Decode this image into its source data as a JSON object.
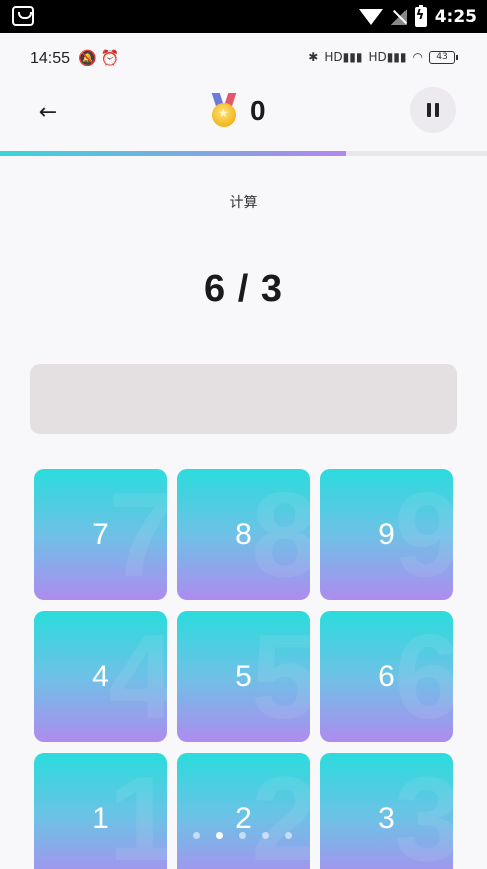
{
  "system_bar": {
    "time": "4:25"
  },
  "status_bar": {
    "time": "14:55",
    "icons_left": [
      "bell-off-icon",
      "alarm-icon"
    ],
    "icons_right": [
      "bluetooth-icon",
      "signal-hd-icon",
      "signal-hd-icon",
      "wifi-icon"
    ],
    "signal_label_1": "HD",
    "signal_label_2": "HD",
    "battery": "43"
  },
  "header": {
    "back_icon": "arrow-left-icon",
    "score_icon": "medal-icon",
    "score": "0",
    "pause_icon": "pause-icon"
  },
  "progress": {
    "value": 0.71,
    "colors": [
      "#38d6da",
      "#b487ef"
    ]
  },
  "operation_label": "计算",
  "question": "6 / 3",
  "answer": {
    "value": ""
  },
  "keypad": {
    "keys": [
      "7",
      "8",
      "9",
      "4",
      "5",
      "6",
      "1",
      "2",
      "3"
    ]
  },
  "pager": {
    "count": 5,
    "active_index": 1
  },
  "colors": {
    "accent_top": "#2adcdc",
    "accent_bottom": "#ad8cef",
    "background": "#f8f7fa",
    "answer_box": "#e4dfe1"
  }
}
